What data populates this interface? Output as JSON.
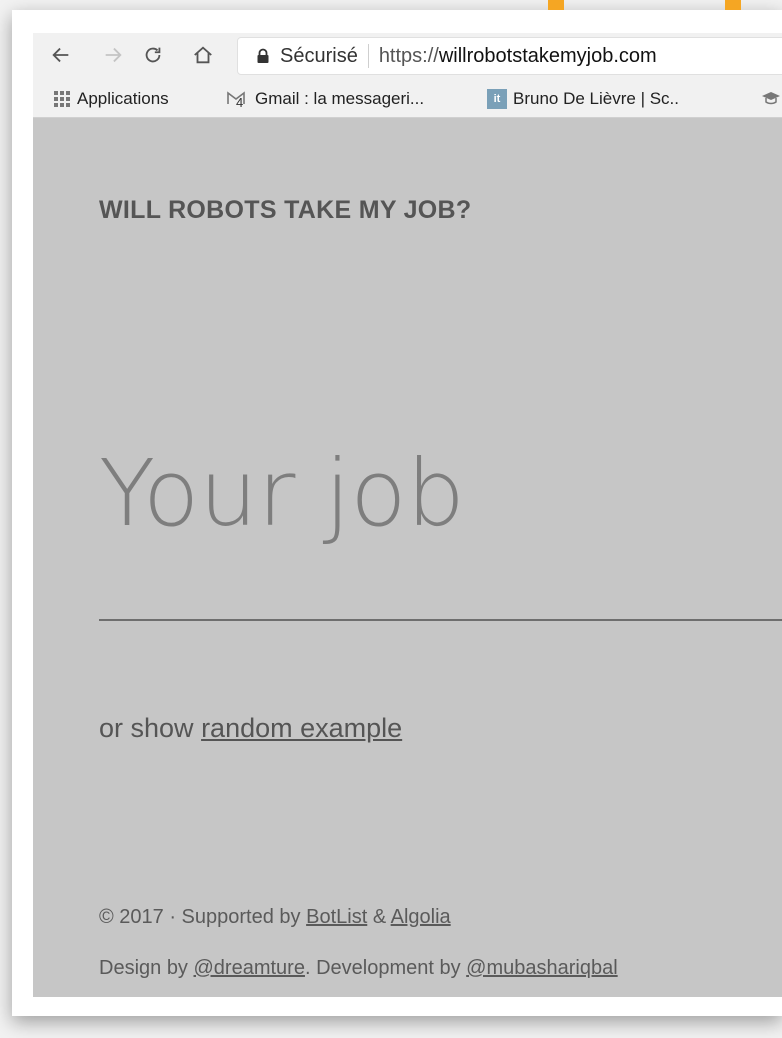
{
  "browser": {
    "secure_label": "Sécurisé",
    "url_protocol": "https://",
    "url_host": "willrobotstakemyjob.com"
  },
  "bookmarks": [
    {
      "label": "Applications",
      "icon": "apps-grid-icon"
    },
    {
      "label": "Gmail : la messageri...",
      "icon": "gmail-icon",
      "badge": "4"
    },
    {
      "label": "Bruno De Lièvre | Sc..",
      "icon": "it-favicon-icon"
    }
  ],
  "site": {
    "title": "WILL ROBOTS TAKE MY JOB?",
    "job_placeholder": "Your job",
    "or_show": "or show",
    "random_example": "random example"
  },
  "footer": {
    "copyright": "© 2017 · Supported by",
    "botlist": "BotList",
    "amp": "&",
    "algolia": "Algolia",
    "design_by": "Design by",
    "dreamture": "@dreamture",
    "development_by": ". Development by",
    "mubashar": "@mubashariqbal"
  },
  "colors": {
    "page_background": "#c6c6c6",
    "text": "#555555",
    "browser_chrome": "#f1f1f1"
  }
}
